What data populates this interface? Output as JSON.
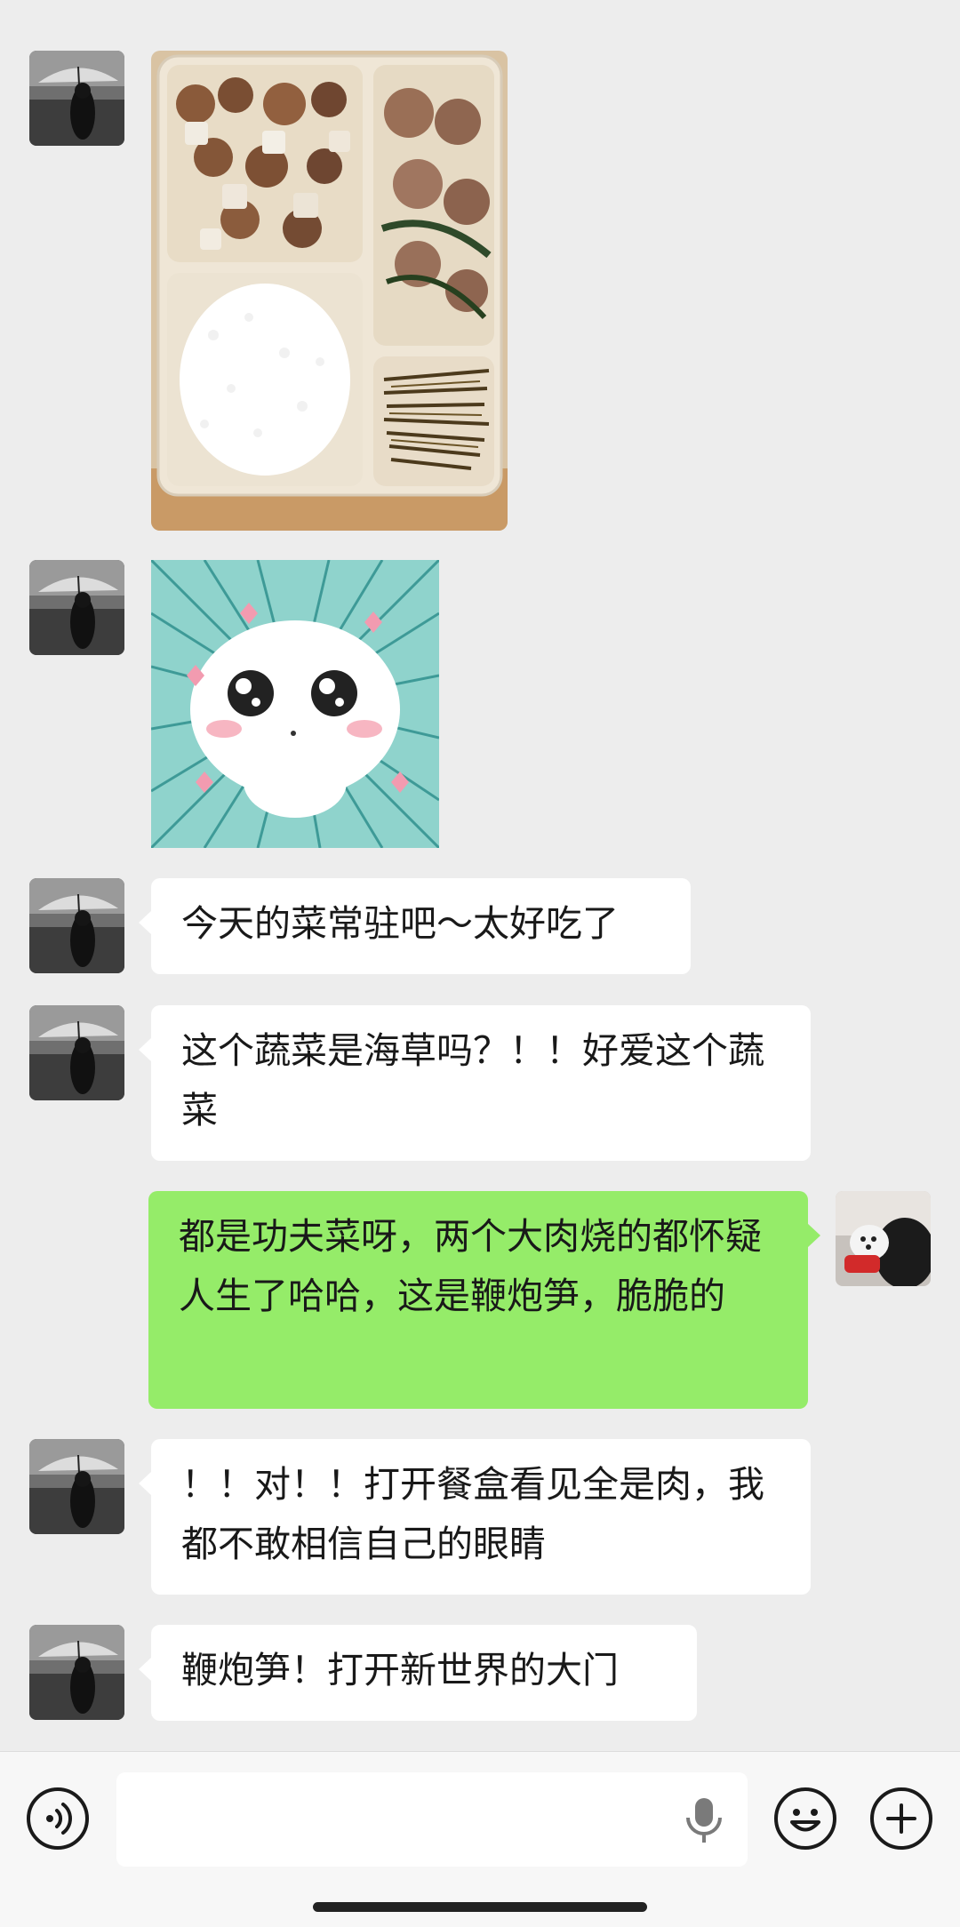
{
  "messages": [
    {
      "id": "m1",
      "sender": "other",
      "type": "image",
      "image_desc": "bento-box-photo"
    },
    {
      "id": "m2",
      "sender": "other",
      "type": "sticker",
      "image_desc": "cute-cat-sticker"
    },
    {
      "id": "m3",
      "sender": "other",
      "type": "text",
      "text": "今天的菜常驻吧～太好吃了"
    },
    {
      "id": "m4",
      "sender": "other",
      "type": "text",
      "text": "这个蔬菜是海草吗？！！好爱这个蔬菜"
    },
    {
      "id": "m5",
      "sender": "me",
      "type": "text",
      "text": "都是功夫菜呀，两个大肉烧的都怀疑人生了哈哈，这是鞭炮笋，脆脆的"
    },
    {
      "id": "m6",
      "sender": "other",
      "type": "text",
      "text": "！！对！！打开餐盒看见全是肉，我都不敢相信自己的眼睛"
    },
    {
      "id": "m7",
      "sender": "other",
      "type": "text",
      "text": "鞭炮笋！打开新世界的大门"
    }
  ],
  "input": {
    "placeholder": "",
    "value": ""
  },
  "icons": {
    "voice": "voice-toggle-icon",
    "mic": "microphone-icon",
    "emoji": "emoji-icon",
    "plus": "plus-icon"
  },
  "colors": {
    "background": "#ededed",
    "incoming_bubble": "#ffffff",
    "outgoing_bubble": "#95ec69",
    "input_bar": "#f7f7f7"
  }
}
